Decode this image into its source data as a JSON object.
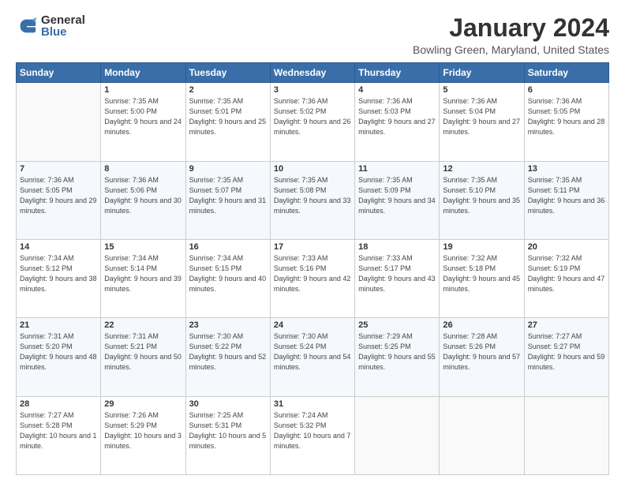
{
  "logo": {
    "general": "General",
    "blue": "Blue"
  },
  "header": {
    "title": "January 2024",
    "subtitle": "Bowling Green, Maryland, United States"
  },
  "weekdays": [
    "Sunday",
    "Monday",
    "Tuesday",
    "Wednesday",
    "Thursday",
    "Friday",
    "Saturday"
  ],
  "weeks": [
    [
      {
        "day": "",
        "sunrise": "",
        "sunset": "",
        "daylight": ""
      },
      {
        "day": "1",
        "sunrise": "7:35 AM",
        "sunset": "5:00 PM",
        "daylight": "9 hours and 24 minutes."
      },
      {
        "day": "2",
        "sunrise": "7:35 AM",
        "sunset": "5:01 PM",
        "daylight": "9 hours and 25 minutes."
      },
      {
        "day": "3",
        "sunrise": "7:36 AM",
        "sunset": "5:02 PM",
        "daylight": "9 hours and 26 minutes."
      },
      {
        "day": "4",
        "sunrise": "7:36 AM",
        "sunset": "5:03 PM",
        "daylight": "9 hours and 27 minutes."
      },
      {
        "day": "5",
        "sunrise": "7:36 AM",
        "sunset": "5:04 PM",
        "daylight": "9 hours and 27 minutes."
      },
      {
        "day": "6",
        "sunrise": "7:36 AM",
        "sunset": "5:05 PM",
        "daylight": "9 hours and 28 minutes."
      }
    ],
    [
      {
        "day": "7",
        "sunrise": "7:36 AM",
        "sunset": "5:05 PM",
        "daylight": "9 hours and 29 minutes."
      },
      {
        "day": "8",
        "sunrise": "7:36 AM",
        "sunset": "5:06 PM",
        "daylight": "9 hours and 30 minutes."
      },
      {
        "day": "9",
        "sunrise": "7:35 AM",
        "sunset": "5:07 PM",
        "daylight": "9 hours and 31 minutes."
      },
      {
        "day": "10",
        "sunrise": "7:35 AM",
        "sunset": "5:08 PM",
        "daylight": "9 hours and 33 minutes."
      },
      {
        "day": "11",
        "sunrise": "7:35 AM",
        "sunset": "5:09 PM",
        "daylight": "9 hours and 34 minutes."
      },
      {
        "day": "12",
        "sunrise": "7:35 AM",
        "sunset": "5:10 PM",
        "daylight": "9 hours and 35 minutes."
      },
      {
        "day": "13",
        "sunrise": "7:35 AM",
        "sunset": "5:11 PM",
        "daylight": "9 hours and 36 minutes."
      }
    ],
    [
      {
        "day": "14",
        "sunrise": "7:34 AM",
        "sunset": "5:12 PM",
        "daylight": "9 hours and 38 minutes."
      },
      {
        "day": "15",
        "sunrise": "7:34 AM",
        "sunset": "5:14 PM",
        "daylight": "9 hours and 39 minutes."
      },
      {
        "day": "16",
        "sunrise": "7:34 AM",
        "sunset": "5:15 PM",
        "daylight": "9 hours and 40 minutes."
      },
      {
        "day": "17",
        "sunrise": "7:33 AM",
        "sunset": "5:16 PM",
        "daylight": "9 hours and 42 minutes."
      },
      {
        "day": "18",
        "sunrise": "7:33 AM",
        "sunset": "5:17 PM",
        "daylight": "9 hours and 43 minutes."
      },
      {
        "day": "19",
        "sunrise": "7:32 AM",
        "sunset": "5:18 PM",
        "daylight": "9 hours and 45 minutes."
      },
      {
        "day": "20",
        "sunrise": "7:32 AM",
        "sunset": "5:19 PM",
        "daylight": "9 hours and 47 minutes."
      }
    ],
    [
      {
        "day": "21",
        "sunrise": "7:31 AM",
        "sunset": "5:20 PM",
        "daylight": "9 hours and 48 minutes."
      },
      {
        "day": "22",
        "sunrise": "7:31 AM",
        "sunset": "5:21 PM",
        "daylight": "9 hours and 50 minutes."
      },
      {
        "day": "23",
        "sunrise": "7:30 AM",
        "sunset": "5:22 PM",
        "daylight": "9 hours and 52 minutes."
      },
      {
        "day": "24",
        "sunrise": "7:30 AM",
        "sunset": "5:24 PM",
        "daylight": "9 hours and 54 minutes."
      },
      {
        "day": "25",
        "sunrise": "7:29 AM",
        "sunset": "5:25 PM",
        "daylight": "9 hours and 55 minutes."
      },
      {
        "day": "26",
        "sunrise": "7:28 AM",
        "sunset": "5:26 PM",
        "daylight": "9 hours and 57 minutes."
      },
      {
        "day": "27",
        "sunrise": "7:27 AM",
        "sunset": "5:27 PM",
        "daylight": "9 hours and 59 minutes."
      }
    ],
    [
      {
        "day": "28",
        "sunrise": "7:27 AM",
        "sunset": "5:28 PM",
        "daylight": "10 hours and 1 minute."
      },
      {
        "day": "29",
        "sunrise": "7:26 AM",
        "sunset": "5:29 PM",
        "daylight": "10 hours and 3 minutes."
      },
      {
        "day": "30",
        "sunrise": "7:25 AM",
        "sunset": "5:31 PM",
        "daylight": "10 hours and 5 minutes."
      },
      {
        "day": "31",
        "sunrise": "7:24 AM",
        "sunset": "5:32 PM",
        "daylight": "10 hours and 7 minutes."
      },
      {
        "day": "",
        "sunrise": "",
        "sunset": "",
        "daylight": ""
      },
      {
        "day": "",
        "sunrise": "",
        "sunset": "",
        "daylight": ""
      },
      {
        "day": "",
        "sunrise": "",
        "sunset": "",
        "daylight": ""
      }
    ]
  ]
}
